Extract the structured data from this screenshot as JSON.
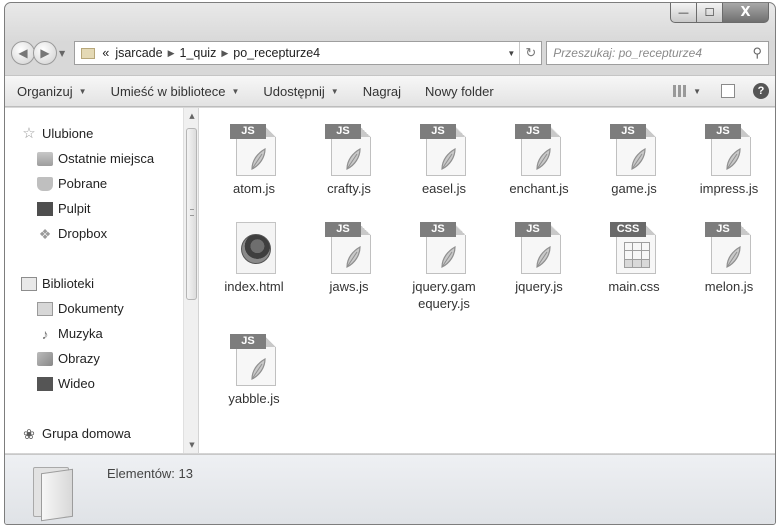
{
  "window": {
    "caption_buttons": {
      "minimize": "—",
      "maximize": "☐",
      "close": "X"
    }
  },
  "nav": {
    "back_icon": "back-arrow-icon",
    "forward_icon": "forward-arrow-icon",
    "address": {
      "overflow": "«",
      "segments": [
        "jsarcade",
        "1_quiz",
        "po_recepturze4"
      ],
      "separator": "▶"
    },
    "search_placeholder": "Przeszukaj: po_recepturze4"
  },
  "commandbar": {
    "items": [
      {
        "label": "Organizuj",
        "has_dropdown": true
      },
      {
        "label": "Umieść w bibliotece",
        "has_dropdown": true
      },
      {
        "label": "Udostępnij",
        "has_dropdown": true
      },
      {
        "label": "Nagraj",
        "has_dropdown": false
      },
      {
        "label": "Nowy folder",
        "has_dropdown": false
      }
    ],
    "help": "?"
  },
  "sidebar": {
    "favorites": [
      {
        "label": "Ulubione",
        "icon": "star-icon"
      },
      {
        "label": "Ostatnie miejsca",
        "icon": "recent-places-icon"
      },
      {
        "label": "Pobrane",
        "icon": "downloads-icon"
      },
      {
        "label": "Pulpit",
        "icon": "desktop-icon"
      },
      {
        "label": "Dropbox",
        "icon": "dropbox-icon"
      }
    ],
    "libraries": [
      {
        "label": "Biblioteki",
        "icon": "libraries-icon"
      },
      {
        "label": "Dokumenty",
        "icon": "documents-icon"
      },
      {
        "label": "Muzyka",
        "icon": "music-icon"
      },
      {
        "label": "Obrazy",
        "icon": "pictures-icon"
      },
      {
        "label": "Wideo",
        "icon": "video-icon"
      }
    ],
    "homegroup": {
      "label": "Grupa domowa",
      "icon": "homegroup-icon"
    }
  },
  "files": [
    {
      "name": "atom.js",
      "type": "JS"
    },
    {
      "name": "crafty.js",
      "type": "JS"
    },
    {
      "name": "easel.js",
      "type": "JS"
    },
    {
      "name": "enchant.js",
      "type": "JS"
    },
    {
      "name": "game.js",
      "type": "JS"
    },
    {
      "name": "impress.js",
      "type": "JS"
    },
    {
      "name": "index.html",
      "type": "HTML"
    },
    {
      "name": "jaws.js",
      "type": "JS"
    },
    {
      "name": "jquery.gam\nequery.js",
      "type": "JS"
    },
    {
      "name": "jquery.js",
      "type": "JS"
    },
    {
      "name": "main.css",
      "type": "CSS"
    },
    {
      "name": "melon.js",
      "type": "JS"
    },
    {
      "name": "yabble.js",
      "type": "JS"
    }
  ],
  "status": {
    "count_text": "Elementów: 13"
  }
}
